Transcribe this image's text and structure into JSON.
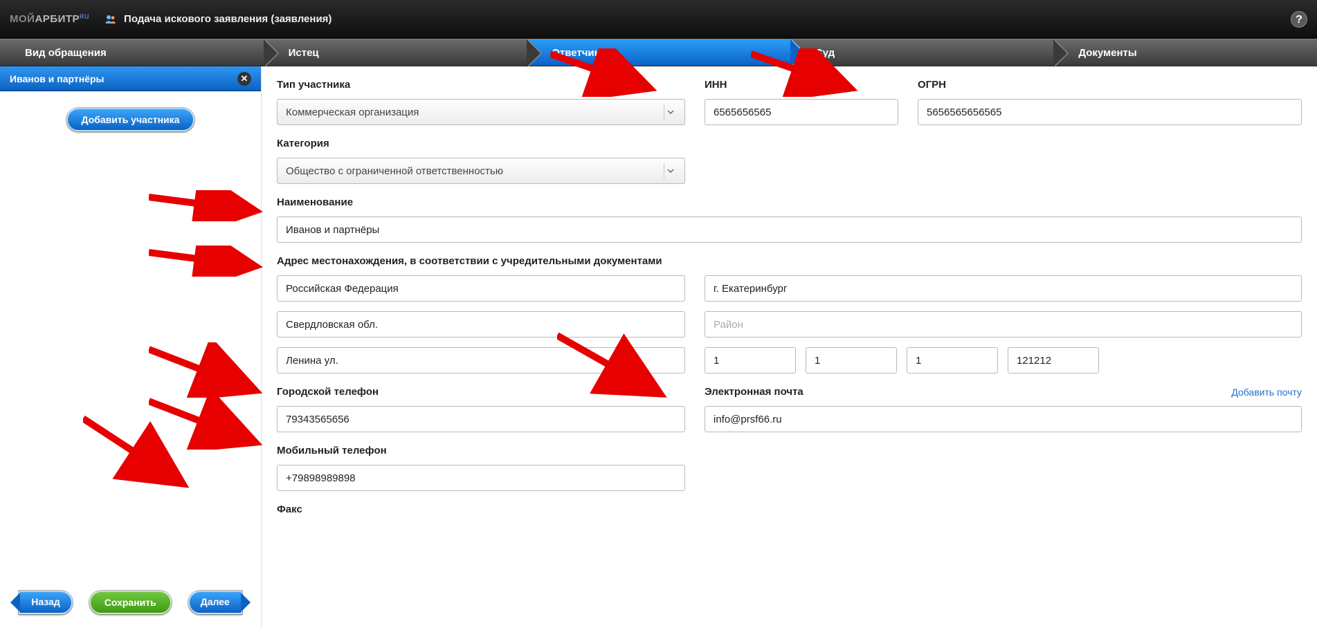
{
  "logo": {
    "prefix": "МОЙ",
    "word": "АРБИТР",
    "suffix": "RU"
  },
  "app_title": "Подача искового заявления (заявления)",
  "steps": {
    "s1": "Вид обращения",
    "s2": "Истец",
    "s3": "Ответчик",
    "s4": "Суд",
    "s5": "Документы"
  },
  "sidebar": {
    "active_participant": "Иванов и партнёры",
    "add_btn": "Добавить участника",
    "back": "Назад",
    "save": "Сохранить",
    "next": "Далее"
  },
  "form": {
    "labels": {
      "type": "Тип участника",
      "inn": "ИНН",
      "ogrn": "ОГРН",
      "category": "Категория",
      "name": "Наименование",
      "address": "Адрес местонахождения, в соответствии с учредительными документами",
      "city_phone": "Городской телефон",
      "mobile_phone": "Мобильный телефон",
      "fax": "Факс",
      "email": "Электронная почта",
      "add_email": "Добавить почту"
    },
    "values": {
      "type_selected": "Коммерческая организация",
      "category_selected": "Общество с ограниченной ответственностью",
      "inn": "6565656565",
      "ogrn": "5656565656565",
      "name": "Иванов и партнёры",
      "country": "Российская Федерация",
      "city": "г. Екатеринбург",
      "region": "Свердловская обл.",
      "district_placeholder": "Район",
      "street": "Ленина ул.",
      "house": "1",
      "building": "1",
      "structure": "1",
      "postcode": "121212",
      "city_phone": "79343565656",
      "mobile_phone": "+79898989898",
      "email": "info@prsf66.ru"
    }
  }
}
